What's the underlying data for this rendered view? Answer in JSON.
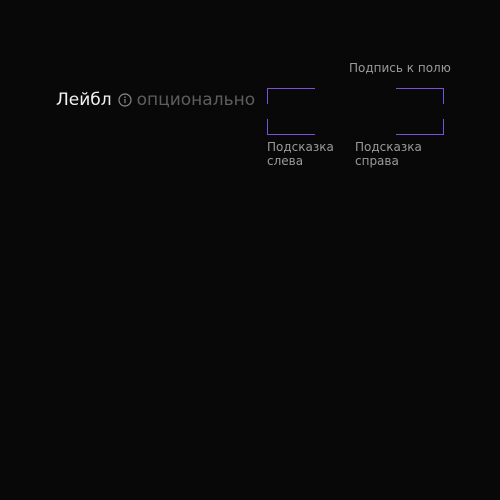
{
  "field": {
    "caption": "Подпись к полю",
    "label": "Лейбл",
    "optional": "опционально",
    "info_icon": "info-circle-icon",
    "hint_left": "Подсказка слева",
    "hint_right": "Подсказка справа",
    "value": "",
    "accent_color": "#7b4fe0",
    "background_color": "#080808"
  }
}
